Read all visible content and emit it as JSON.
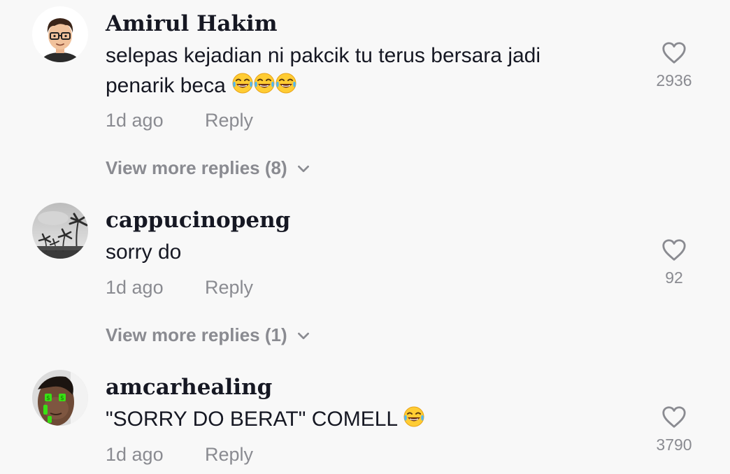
{
  "comments": [
    {
      "username": "Amirul Hakim",
      "text": "selepas kejadian ni pakcik tu terus bersara jadi penarik beca",
      "emoji": [
        "face-with-tears-of-joy",
        "face-with-tears-of-joy",
        "face-with-tears-of-joy"
      ],
      "time": "1d ago",
      "reply_label": "Reply",
      "likes": "2936",
      "more_replies": "View more replies (8)",
      "avatar": "cartoon-avatar-with-glasses"
    },
    {
      "username": "cappucinopeng",
      "text": "sorry do",
      "time": "1d ago",
      "reply_label": "Reply",
      "likes": "92",
      "more_replies": "View more replies (1)",
      "avatar": "grayscale-palm-trees-photo"
    },
    {
      "username": "amcarhealing",
      "text": "\"SORRY DO BERAT\" COMELL",
      "emoji": [
        "face-with-tears-of-joy"
      ],
      "time": "1d ago",
      "reply_label": "Reply",
      "likes": "3790",
      "avatar": "face-with-green-dollar-eyes"
    }
  ],
  "colors": {
    "background": "#f8f8f8",
    "primary_text": "#161823",
    "secondary_text": "#8a8b91"
  },
  "icons": {
    "like": "heart-outline-icon",
    "expand": "chevron-down-icon"
  }
}
